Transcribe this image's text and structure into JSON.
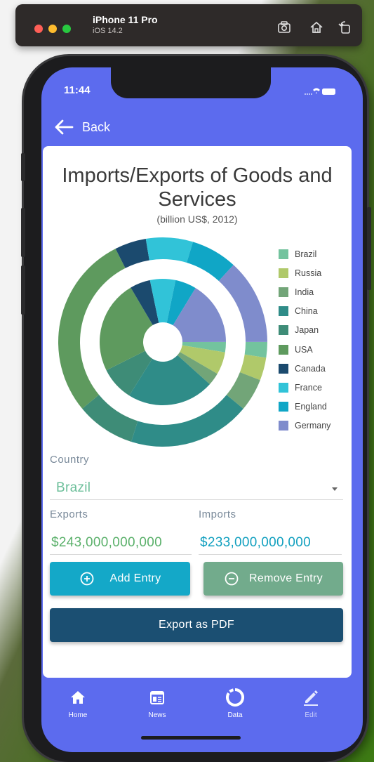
{
  "simulator": {
    "device": "iPhone 11 Pro",
    "os": "iOS 14.2",
    "icons": [
      "screenshot-icon",
      "home-icon",
      "rotate-icon"
    ]
  },
  "status_bar": {
    "time": "11:44"
  },
  "nav": {
    "back_label": "Back"
  },
  "chart_data": {
    "type": "pie",
    "title": "Imports/Exports of Goods and Services",
    "subtitle": "(billion US$, 2012)",
    "categories": [
      "Brazil",
      "Russia",
      "India",
      "China",
      "Japan",
      "USA",
      "Canada",
      "France",
      "England",
      "Germany"
    ],
    "colors": [
      "#73c39e",
      "#b0c96a",
      "#72a578",
      "#2f8c88",
      "#3e8c77",
      "#5e9a5e",
      "#1b4a6e",
      "#31c3d8",
      "#10a6c6",
      "#7f8ccc"
    ],
    "series": [
      {
        "name": "Exports",
        "ring": "inner",
        "values": [
          243,
          530,
          300,
          2050,
          800,
          2200,
          480,
          600,
          500,
          1500
        ]
      },
      {
        "name": "Imports",
        "ring": "outer",
        "values": [
          233,
          340,
          490,
          1820,
          880,
          2750,
          470,
          700,
          690,
          1270
        ]
      }
    ],
    "legend": "right"
  },
  "form": {
    "country_label": "Country",
    "country_value": "Brazil",
    "exports_label": "Exports",
    "imports_label": "Imports",
    "exports_value": "$243,000,000,000",
    "imports_value": "$233,000,000,000",
    "add_label": "Add Entry",
    "remove_label": "Remove Entry",
    "pdf_label": "Export as PDF"
  },
  "tabs": [
    {
      "label": "Home",
      "icon": "home-icon",
      "active": true
    },
    {
      "label": "News",
      "icon": "news-icon",
      "active": true
    },
    {
      "label": "Data",
      "icon": "data-icon",
      "active": true
    },
    {
      "label": "Edit",
      "icon": "edit-icon",
      "active": false
    }
  ],
  "colors": {
    "app_bar": "#5c6bee",
    "add_button": "#14a8c8",
    "remove_button": "#72ab8c",
    "pdf_button": "#1b4f72",
    "exports_value": "#5ab06a",
    "imports_value": "#12a0bf"
  }
}
